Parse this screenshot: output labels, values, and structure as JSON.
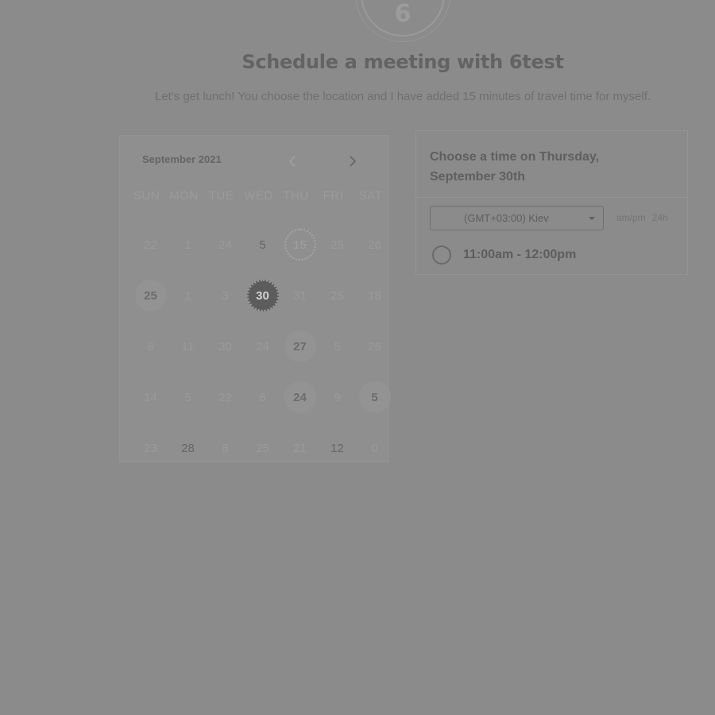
{
  "avatar": {
    "letter": "6"
  },
  "header": {
    "title": "Schedule a meeting with 6test",
    "description": "Let's get lunch! You choose the location and I have added 15 minutes of travel time for myself."
  },
  "calendar": {
    "month_label": "September 2021",
    "weekdays": [
      "SUN",
      "MON",
      "TUE",
      "WED",
      "THU",
      "FRI",
      "SAT"
    ],
    "weeks": [
      [
        {
          "label": "22",
          "state": "disabled"
        },
        {
          "label": "1",
          "state": "disabled"
        },
        {
          "label": "24",
          "state": "disabled"
        },
        {
          "label": "5",
          "state": "dark"
        },
        {
          "label": "15",
          "state": "today"
        },
        {
          "label": "25",
          "state": "disabled"
        },
        {
          "label": "26",
          "state": "disabled"
        }
      ],
      [
        {
          "label": "25",
          "state": "available"
        },
        {
          "label": "1",
          "state": "disabled"
        },
        {
          "label": "3",
          "state": "disabled"
        },
        {
          "label": "30",
          "state": "selected"
        },
        {
          "label": "31",
          "state": "disabled"
        },
        {
          "label": "25",
          "state": "disabled"
        },
        {
          "label": "18",
          "state": "disabled"
        }
      ],
      [
        {
          "label": "8",
          "state": "disabled"
        },
        {
          "label": "11",
          "state": "disabled"
        },
        {
          "label": "30",
          "state": "disabled"
        },
        {
          "label": "24",
          "state": "disabled"
        },
        {
          "label": "27",
          "state": "available"
        },
        {
          "label": "5",
          "state": "disabled"
        },
        {
          "label": "26",
          "state": "disabled"
        }
      ],
      [
        {
          "label": "14",
          "state": "disabled"
        },
        {
          "label": "5",
          "state": "disabled"
        },
        {
          "label": "22",
          "state": "disabled"
        },
        {
          "label": "8",
          "state": "disabled"
        },
        {
          "label": "24",
          "state": "available"
        },
        {
          "label": "9",
          "state": "disabled"
        },
        {
          "label": "5",
          "state": "available"
        }
      ],
      [
        {
          "label": "23",
          "state": "disabled"
        },
        {
          "label": "28",
          "state": "dark"
        },
        {
          "label": "8",
          "state": "disabled"
        },
        {
          "label": "25",
          "state": "disabled"
        },
        {
          "label": "21",
          "state": "disabled"
        },
        {
          "label": "12",
          "state": "dark"
        },
        {
          "label": "0",
          "state": "disabled"
        }
      ]
    ]
  },
  "time_panel": {
    "heading": "Choose a time on Thursday, September 30th",
    "timezone": "(GMT+03:00) Kiev",
    "format_options": [
      "am/pm",
      "24h"
    ],
    "slots": [
      "11:00am - 12:00pm"
    ]
  }
}
